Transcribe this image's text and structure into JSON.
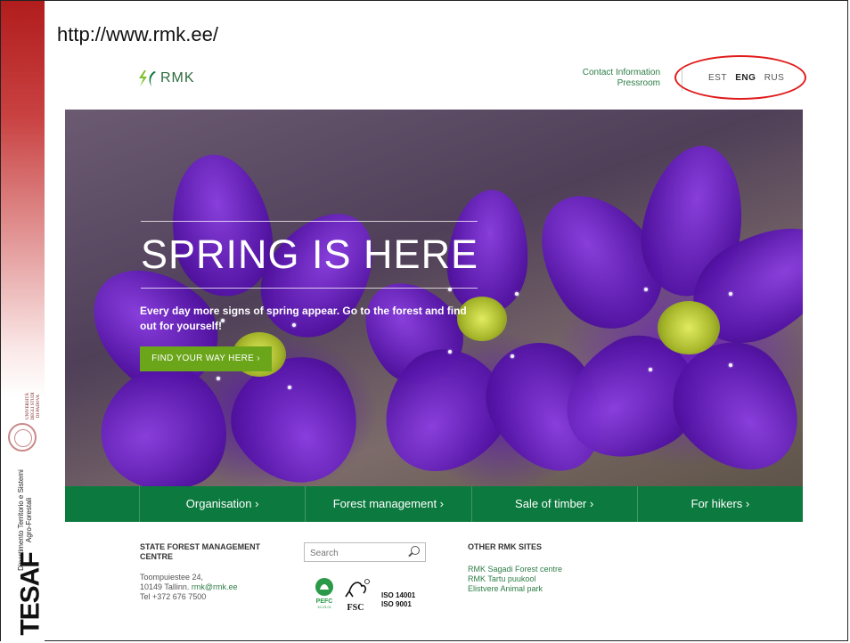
{
  "slide": {
    "url": "http://www.rmk.ee/",
    "university_text": "UNIVERSITÀ\nDEGLI STUDI\nDI PADOVA",
    "department": "Dipartimento Territorio e Sistemi Agro-Forestali",
    "department_logo": "TESAF"
  },
  "site": {
    "logo_text": "RMK",
    "top_links": [
      "Contact Information",
      "Pressroom"
    ],
    "languages": [
      "EST",
      "ENG",
      "RUS"
    ],
    "active_language": "ENG"
  },
  "hero": {
    "title": "SPRING IS HERE",
    "text": "Every day more signs of spring appear. Go to the forest and find out for yourself!",
    "button_label": "FIND YOUR WAY HERE ›"
  },
  "nav": {
    "items": [
      "Organisation ›",
      "Forest management ›",
      "Sale of timber ›",
      "For hikers ›"
    ]
  },
  "footer": {
    "org_name": "STATE FOREST MANAGEMENT CENTRE",
    "address_line1": "Toompuiestee 24,",
    "address_line2": "10149 Tallinn. ",
    "email": "rmk@rmk.ee",
    "phone": "Tel +372 676 7500",
    "search_placeholder": "Search",
    "pefc_label": "PEFC",
    "pefc_code": "19-23-01",
    "fsc_label": "FSC",
    "iso": [
      "ISO 14001",
      "ISO 9001"
    ],
    "other_title": "OTHER RMK SITES",
    "other_links": [
      "RMK Sagadi Forest centre",
      "RMK Tartu puukool",
      "Elistvere Animal park"
    ]
  },
  "colors": {
    "brand_green": "#0c7a3e",
    "button_green": "#6aa51a",
    "annotation_red": "#e01b1b",
    "slide_red": "#b11d1d"
  }
}
